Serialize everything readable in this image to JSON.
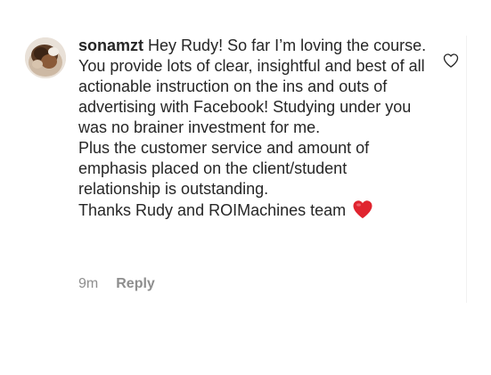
{
  "comment": {
    "username": "sonamzt",
    "paragraphs": [
      "Hey Rudy! So far I’m loving the course. You provide lots of clear, insightful and best of all actionable instruction on the ins and outs of advertising with Facebook! Studying under you was no brainer investment for me.",
      "Plus the customer service and amount of emphasis placed on the client/student relationship is outstanding.",
      "Thanks Rudy and ROIMachines team"
    ],
    "timestamp": "9m",
    "reply_label": "Reply"
  },
  "icons": {
    "like": "heart-outline-icon",
    "emoji": "red-heart-emoji"
  },
  "colors": {
    "text": "#262626",
    "muted": "#8e8e8e",
    "heart": "#e0242f"
  }
}
